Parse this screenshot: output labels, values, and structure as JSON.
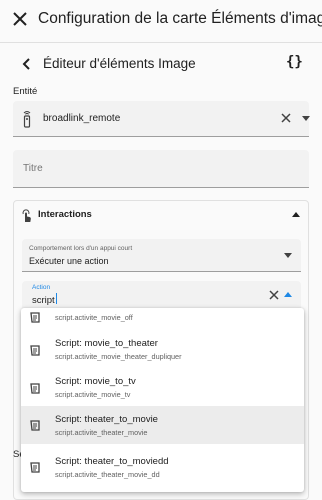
{
  "dialog": {
    "title": "Configuration de la carte Éléments d'image"
  },
  "editor": {
    "title": "Éditeur d'éléments Image",
    "code_toggle": "{}"
  },
  "entity": {
    "label": "Entité",
    "value": "broadlink_remote"
  },
  "title_field": {
    "placeholder": "Titre"
  },
  "interactions": {
    "header": "Interactions",
    "tap_action": {
      "label": "Comportement lors d'un appui court",
      "value": "Exécuter une action"
    },
    "action": {
      "label": "Action",
      "value": "script"
    }
  },
  "below_label": "Sé",
  "dropdown": {
    "items": [
      {
        "primary": "",
        "secondary": "script.activite_movie_off",
        "selected": false
      },
      {
        "primary": "Script: movie_to_theater",
        "secondary": "script.activite_movie_theater_dupliquer",
        "selected": false
      },
      {
        "primary": "Script: movie_to_tv",
        "secondary": "script.activite_movie_tv",
        "selected": false
      },
      {
        "primary": "Script: theater_to_movie",
        "secondary": "script.activite_theater_movie",
        "selected": true
      },
      {
        "primary": "Script: theater_to_moviedd",
        "secondary": "script.activite_theater_movie_dd",
        "selected": false
      }
    ]
  },
  "colors": {
    "accent": "#1e88e5",
    "background": "#fafafa",
    "field_bg": "#f2f2f2",
    "selected_row": "#ececec"
  },
  "icons": {
    "close": "close-icon",
    "back": "back-arrow-icon",
    "remote": "remote-icon",
    "interactions": "gesture-tap-icon",
    "script": "script-text-icon"
  }
}
